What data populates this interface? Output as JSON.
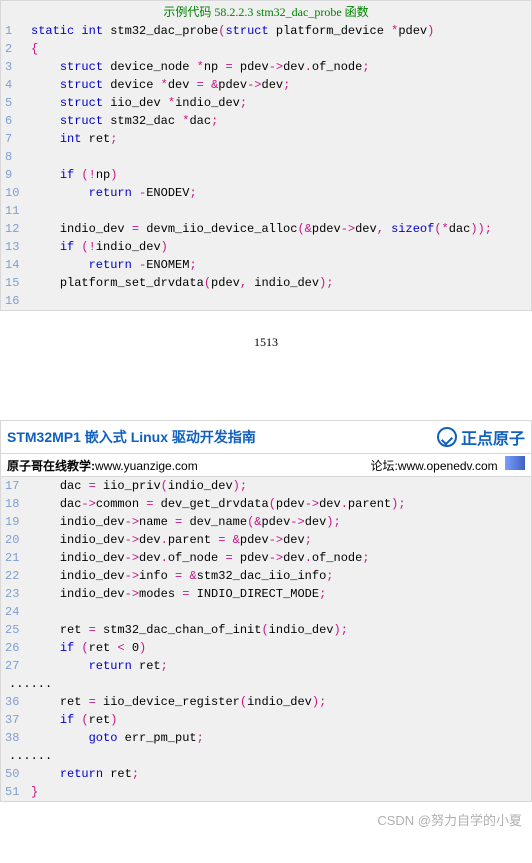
{
  "code_top_title": "示例代码 58.2.2.3 stm32_dac_probe 函数",
  "page_number": "1513",
  "doc_title": "STM32MP1 嵌入式 Linux 驱动开发指南",
  "brand_text": "正点原子",
  "sub_left_label": "原子哥在线教学:",
  "sub_left_link": "www.yuanzige.com",
  "sub_right_label": "论坛:",
  "sub_right_link": "www.openedv.com",
  "footer_credit": "CSDN @努力自学的小夏",
  "lines_top": [
    {
      "n": "1",
      "tokens": [
        {
          "t": "static",
          "c": "kw"
        },
        {
          "t": " "
        },
        {
          "t": "int",
          "c": "kw"
        },
        {
          "t": " "
        },
        {
          "t": "stm32_dac_probe",
          "c": "fn"
        },
        {
          "t": "(",
          "c": "sym"
        },
        {
          "t": "struct",
          "c": "kw"
        },
        {
          "t": " "
        },
        {
          "t": "platform_device",
          "c": "id"
        },
        {
          "t": " "
        },
        {
          "t": "*",
          "c": "op"
        },
        {
          "t": "pdev",
          "c": "id"
        },
        {
          "t": ")",
          "c": "sym"
        }
      ]
    },
    {
      "n": "2",
      "tokens": [
        {
          "t": "{",
          "c": "sym"
        }
      ]
    },
    {
      "n": "3",
      "indent": "    ",
      "tokens": [
        {
          "t": "struct",
          "c": "kw"
        },
        {
          "t": " "
        },
        {
          "t": "device_node",
          "c": "id"
        },
        {
          "t": " "
        },
        {
          "t": "*",
          "c": "op"
        },
        {
          "t": "np",
          "c": "id"
        },
        {
          "t": " "
        },
        {
          "t": "=",
          "c": "op"
        },
        {
          "t": " "
        },
        {
          "t": "pdev",
          "c": "id"
        },
        {
          "t": "->",
          "c": "op"
        },
        {
          "t": "dev",
          "c": "id"
        },
        {
          "t": ".",
          "c": "op"
        },
        {
          "t": "of_node",
          "c": "id"
        },
        {
          "t": ";",
          "c": "sym"
        }
      ]
    },
    {
      "n": "4",
      "indent": "    ",
      "tokens": [
        {
          "t": "struct",
          "c": "kw"
        },
        {
          "t": " "
        },
        {
          "t": "device",
          "c": "id"
        },
        {
          "t": " "
        },
        {
          "t": "*",
          "c": "op"
        },
        {
          "t": "dev",
          "c": "id"
        },
        {
          "t": " "
        },
        {
          "t": "=",
          "c": "op"
        },
        {
          "t": " "
        },
        {
          "t": "&",
          "c": "op"
        },
        {
          "t": "pdev",
          "c": "id"
        },
        {
          "t": "->",
          "c": "op"
        },
        {
          "t": "dev",
          "c": "id"
        },
        {
          "t": ";",
          "c": "sym"
        }
      ]
    },
    {
      "n": "5",
      "indent": "    ",
      "tokens": [
        {
          "t": "struct",
          "c": "kw"
        },
        {
          "t": " "
        },
        {
          "t": "iio_dev",
          "c": "id"
        },
        {
          "t": " "
        },
        {
          "t": "*",
          "c": "op"
        },
        {
          "t": "indio_dev",
          "c": "id"
        },
        {
          "t": ";",
          "c": "sym"
        }
      ]
    },
    {
      "n": "6",
      "indent": "    ",
      "tokens": [
        {
          "t": "struct",
          "c": "kw"
        },
        {
          "t": " "
        },
        {
          "t": "stm32_dac",
          "c": "id"
        },
        {
          "t": " "
        },
        {
          "t": "*",
          "c": "op"
        },
        {
          "t": "dac",
          "c": "id"
        },
        {
          "t": ";",
          "c": "sym"
        }
      ]
    },
    {
      "n": "7",
      "indent": "    ",
      "tokens": [
        {
          "t": "int",
          "c": "kw"
        },
        {
          "t": " "
        },
        {
          "t": "ret",
          "c": "id"
        },
        {
          "t": ";",
          "c": "sym"
        }
      ]
    },
    {
      "n": "8",
      "tokens": []
    },
    {
      "n": "9",
      "indent": "    ",
      "tokens": [
        {
          "t": "if",
          "c": "kw"
        },
        {
          "t": " "
        },
        {
          "t": "(",
          "c": "sym"
        },
        {
          "t": "!",
          "c": "op"
        },
        {
          "t": "np",
          "c": "id"
        },
        {
          "t": ")",
          "c": "sym"
        }
      ]
    },
    {
      "n": "10",
      "indent": "        ",
      "tokens": [
        {
          "t": "return",
          "c": "kw"
        },
        {
          "t": " "
        },
        {
          "t": "-",
          "c": "op"
        },
        {
          "t": "ENODEV",
          "c": "id"
        },
        {
          "t": ";",
          "c": "sym"
        }
      ]
    },
    {
      "n": "11",
      "tokens": []
    },
    {
      "n": "12",
      "indent": "    ",
      "tokens": [
        {
          "t": "indio_dev",
          "c": "id"
        },
        {
          "t": " "
        },
        {
          "t": "=",
          "c": "op"
        },
        {
          "t": " "
        },
        {
          "t": "devm_iio_device_alloc",
          "c": "fn"
        },
        {
          "t": "(",
          "c": "sym"
        },
        {
          "t": "&",
          "c": "op"
        },
        {
          "t": "pdev",
          "c": "id"
        },
        {
          "t": "->",
          "c": "op"
        },
        {
          "t": "dev",
          "c": "id"
        },
        {
          "t": ",",
          "c": "sym"
        },
        {
          "t": " "
        },
        {
          "t": "sizeof",
          "c": "kw"
        },
        {
          "t": "(",
          "c": "sym"
        },
        {
          "t": "*",
          "c": "op"
        },
        {
          "t": "dac",
          "c": "id"
        },
        {
          "t": ")",
          "c": "sym"
        },
        {
          "t": ")",
          "c": "sym"
        },
        {
          "t": ";",
          "c": "sym"
        }
      ]
    },
    {
      "n": "13",
      "indent": "    ",
      "tokens": [
        {
          "t": "if",
          "c": "kw"
        },
        {
          "t": " "
        },
        {
          "t": "(",
          "c": "sym"
        },
        {
          "t": "!",
          "c": "op"
        },
        {
          "t": "indio_dev",
          "c": "id"
        },
        {
          "t": ")",
          "c": "sym"
        }
      ]
    },
    {
      "n": "14",
      "indent": "        ",
      "tokens": [
        {
          "t": "return",
          "c": "kw"
        },
        {
          "t": " "
        },
        {
          "t": "-",
          "c": "op"
        },
        {
          "t": "ENOMEM",
          "c": "id"
        },
        {
          "t": ";",
          "c": "sym"
        }
      ]
    },
    {
      "n": "15",
      "indent": "    ",
      "tokens": [
        {
          "t": "platform_set_drvdata",
          "c": "fn"
        },
        {
          "t": "(",
          "c": "sym"
        },
        {
          "t": "pdev",
          "c": "id"
        },
        {
          "t": ",",
          "c": "sym"
        },
        {
          "t": " "
        },
        {
          "t": "indio_dev",
          "c": "id"
        },
        {
          "t": ")",
          "c": "sym"
        },
        {
          "t": ";",
          "c": "sym"
        }
      ]
    },
    {
      "n": "16",
      "tokens": []
    }
  ],
  "lines_bottom": [
    {
      "n": "17",
      "indent": "    ",
      "tokens": [
        {
          "t": "dac",
          "c": "id"
        },
        {
          "t": " "
        },
        {
          "t": "=",
          "c": "op"
        },
        {
          "t": " "
        },
        {
          "t": "iio_priv",
          "c": "fn"
        },
        {
          "t": "(",
          "c": "sym"
        },
        {
          "t": "indio_dev",
          "c": "id"
        },
        {
          "t": ")",
          "c": "sym"
        },
        {
          "t": ";",
          "c": "sym"
        }
      ]
    },
    {
      "n": "18",
      "indent": "    ",
      "tokens": [
        {
          "t": "dac",
          "c": "id"
        },
        {
          "t": "->",
          "c": "op"
        },
        {
          "t": "common",
          "c": "id"
        },
        {
          "t": " "
        },
        {
          "t": "=",
          "c": "op"
        },
        {
          "t": " "
        },
        {
          "t": "dev_get_drvdata",
          "c": "fn"
        },
        {
          "t": "(",
          "c": "sym"
        },
        {
          "t": "pdev",
          "c": "id"
        },
        {
          "t": "->",
          "c": "op"
        },
        {
          "t": "dev",
          "c": "id"
        },
        {
          "t": ".",
          "c": "op"
        },
        {
          "t": "parent",
          "c": "id"
        },
        {
          "t": ")",
          "c": "sym"
        },
        {
          "t": ";",
          "c": "sym"
        }
      ]
    },
    {
      "n": "19",
      "indent": "    ",
      "tokens": [
        {
          "t": "indio_dev",
          "c": "id"
        },
        {
          "t": "->",
          "c": "op"
        },
        {
          "t": "name",
          "c": "id"
        },
        {
          "t": " "
        },
        {
          "t": "=",
          "c": "op"
        },
        {
          "t": " "
        },
        {
          "t": "dev_name",
          "c": "fn"
        },
        {
          "t": "(",
          "c": "sym"
        },
        {
          "t": "&",
          "c": "op"
        },
        {
          "t": "pdev",
          "c": "id"
        },
        {
          "t": "->",
          "c": "op"
        },
        {
          "t": "dev",
          "c": "id"
        },
        {
          "t": ")",
          "c": "sym"
        },
        {
          "t": ";",
          "c": "sym"
        }
      ]
    },
    {
      "n": "20",
      "indent": "    ",
      "tokens": [
        {
          "t": "indio_dev",
          "c": "id"
        },
        {
          "t": "->",
          "c": "op"
        },
        {
          "t": "dev",
          "c": "id"
        },
        {
          "t": ".",
          "c": "op"
        },
        {
          "t": "parent",
          "c": "id"
        },
        {
          "t": " "
        },
        {
          "t": "=",
          "c": "op"
        },
        {
          "t": " "
        },
        {
          "t": "&",
          "c": "op"
        },
        {
          "t": "pdev",
          "c": "id"
        },
        {
          "t": "->",
          "c": "op"
        },
        {
          "t": "dev",
          "c": "id"
        },
        {
          "t": ";",
          "c": "sym"
        }
      ]
    },
    {
      "n": "21",
      "indent": "    ",
      "tokens": [
        {
          "t": "indio_dev",
          "c": "id"
        },
        {
          "t": "->",
          "c": "op"
        },
        {
          "t": "dev",
          "c": "id"
        },
        {
          "t": ".",
          "c": "op"
        },
        {
          "t": "of_node",
          "c": "id"
        },
        {
          "t": " "
        },
        {
          "t": "=",
          "c": "op"
        },
        {
          "t": " "
        },
        {
          "t": "pdev",
          "c": "id"
        },
        {
          "t": "->",
          "c": "op"
        },
        {
          "t": "dev",
          "c": "id"
        },
        {
          "t": ".",
          "c": "op"
        },
        {
          "t": "of_node",
          "c": "id"
        },
        {
          "t": ";",
          "c": "sym"
        }
      ]
    },
    {
      "n": "22",
      "indent": "    ",
      "tokens": [
        {
          "t": "indio_dev",
          "c": "id"
        },
        {
          "t": "->",
          "c": "op"
        },
        {
          "t": "info",
          "c": "id"
        },
        {
          "t": " "
        },
        {
          "t": "=",
          "c": "op"
        },
        {
          "t": " "
        },
        {
          "t": "&",
          "c": "op"
        },
        {
          "t": "stm32_dac_iio_info",
          "c": "id"
        },
        {
          "t": ";",
          "c": "sym"
        }
      ]
    },
    {
      "n": "23",
      "indent": "    ",
      "tokens": [
        {
          "t": "indio_dev",
          "c": "id"
        },
        {
          "t": "->",
          "c": "op"
        },
        {
          "t": "modes",
          "c": "id"
        },
        {
          "t": " "
        },
        {
          "t": "=",
          "c": "op"
        },
        {
          "t": " "
        },
        {
          "t": "INDIO_DIRECT_MODE",
          "c": "id"
        },
        {
          "t": ";",
          "c": "sym"
        }
      ]
    },
    {
      "n": "24",
      "tokens": []
    },
    {
      "n": "25",
      "indent": "    ",
      "tokens": [
        {
          "t": "ret",
          "c": "id"
        },
        {
          "t": " "
        },
        {
          "t": "=",
          "c": "op"
        },
        {
          "t": " "
        },
        {
          "t": "stm32_dac_chan_of_init",
          "c": "fn"
        },
        {
          "t": "(",
          "c": "sym"
        },
        {
          "t": "indio_dev",
          "c": "id"
        },
        {
          "t": ")",
          "c": "sym"
        },
        {
          "t": ";",
          "c": "sym"
        }
      ]
    },
    {
      "n": "26",
      "indent": "    ",
      "tokens": [
        {
          "t": "if",
          "c": "kw"
        },
        {
          "t": " "
        },
        {
          "t": "(",
          "c": "sym"
        },
        {
          "t": "ret",
          "c": "id"
        },
        {
          "t": " "
        },
        {
          "t": "<",
          "c": "op"
        },
        {
          "t": " "
        },
        {
          "t": "0",
          "c": "id"
        },
        {
          "t": ")",
          "c": "sym"
        }
      ]
    },
    {
      "n": "27",
      "indent": "        ",
      "tokens": [
        {
          "t": "return",
          "c": "kw"
        },
        {
          "t": " "
        },
        {
          "t": "ret",
          "c": "id"
        },
        {
          "t": ";",
          "c": "sym"
        }
      ]
    },
    {
      "n": "......",
      "tokens": []
    },
    {
      "n": "36",
      "indent": "    ",
      "tokens": [
        {
          "t": "ret",
          "c": "id"
        },
        {
          "t": " "
        },
        {
          "t": "=",
          "c": "op"
        },
        {
          "t": " "
        },
        {
          "t": "iio_device_register",
          "c": "fn"
        },
        {
          "t": "(",
          "c": "sym"
        },
        {
          "t": "indio_dev",
          "c": "id"
        },
        {
          "t": ")",
          "c": "sym"
        },
        {
          "t": ";",
          "c": "sym"
        }
      ]
    },
    {
      "n": "37",
      "indent": "    ",
      "tokens": [
        {
          "t": "if",
          "c": "kw"
        },
        {
          "t": " "
        },
        {
          "t": "(",
          "c": "sym"
        },
        {
          "t": "ret",
          "c": "id"
        },
        {
          "t": ")",
          "c": "sym"
        }
      ]
    },
    {
      "n": "38",
      "indent": "        ",
      "tokens": [
        {
          "t": "goto",
          "c": "kw"
        },
        {
          "t": " "
        },
        {
          "t": "err_pm_put",
          "c": "id"
        },
        {
          "t": ";",
          "c": "sym"
        }
      ]
    },
    {
      "n": "......",
      "tokens": []
    },
    {
      "n": "50",
      "indent": "    ",
      "tokens": [
        {
          "t": "return",
          "c": "kw"
        },
        {
          "t": " "
        },
        {
          "t": "ret",
          "c": "id"
        },
        {
          "t": ";",
          "c": "sym"
        }
      ]
    },
    {
      "n": "51",
      "tokens": [
        {
          "t": "}",
          "c": "sym"
        }
      ]
    }
  ]
}
